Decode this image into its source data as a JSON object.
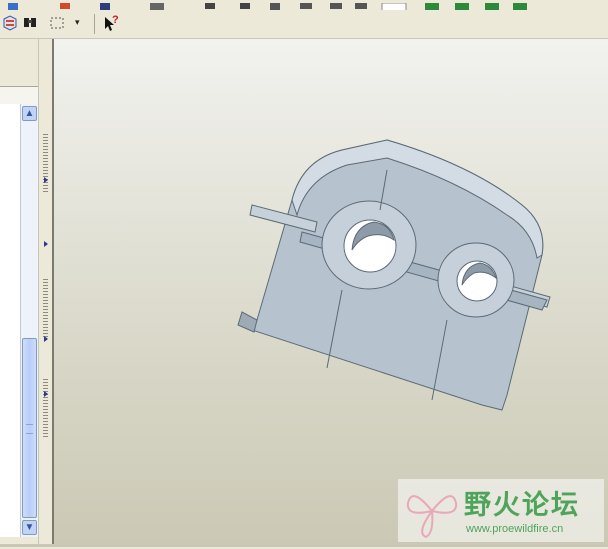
{
  "toolbar": {
    "question_tool": "?",
    "icons": [
      "datum-axis-icon",
      "refresh-icon",
      "find-icon",
      "select-box-icon",
      "dropdown-icon",
      "whats-this-icon"
    ]
  },
  "model_tree": {
    "scroll_up": "▲",
    "scroll_down": "▼"
  },
  "viewport": {
    "model_color": "#b6c3cf",
    "background_top": "#f2f2ef",
    "background_bottom": "#cbc9b5"
  },
  "watermark": {
    "title": "野火论坛",
    "url": "www.proewildfire.cn"
  }
}
